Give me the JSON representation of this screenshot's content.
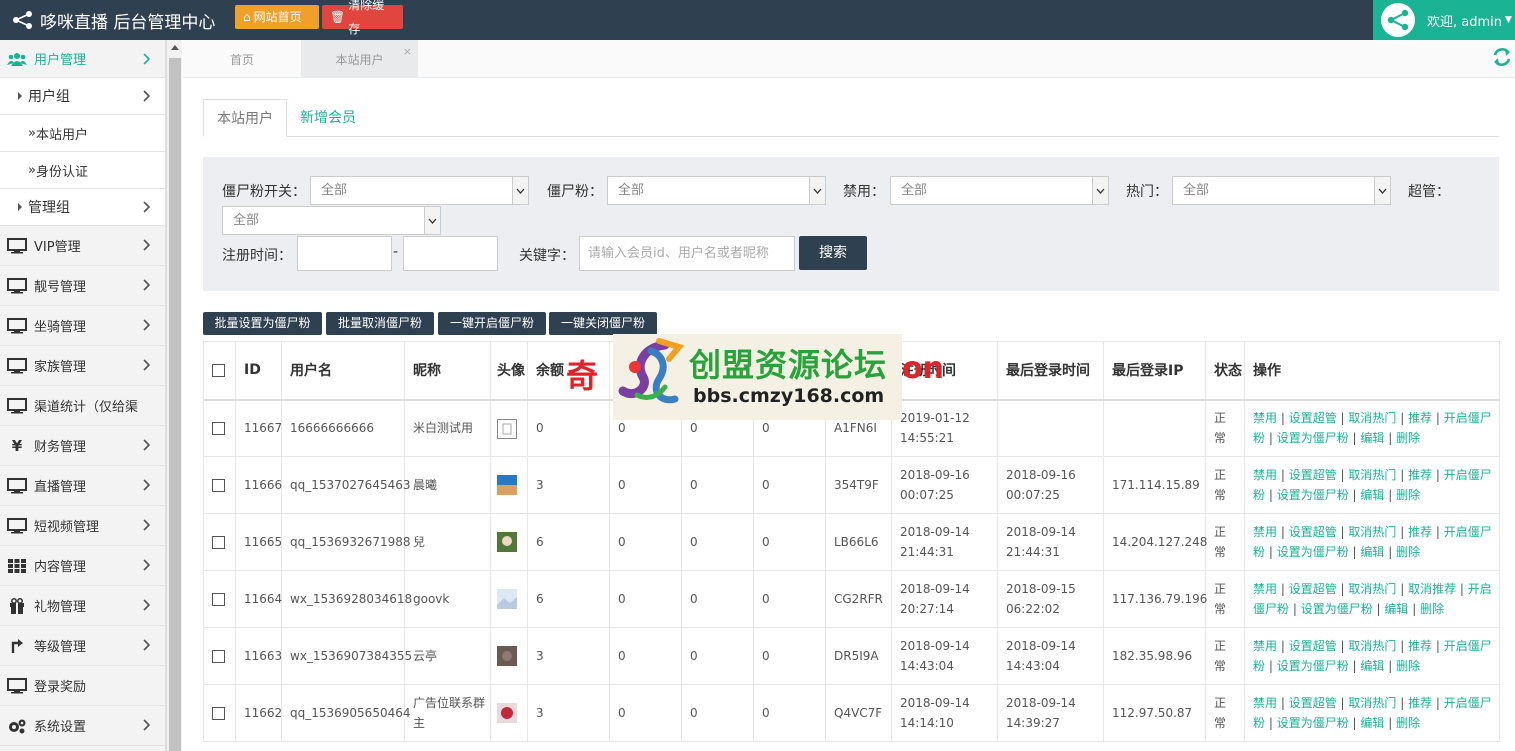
{
  "header": {
    "brand": "哆咪直播 后台管理中心",
    "btn_home": "网站首页",
    "btn_cache": "清除缓存",
    "welcome": "欢迎, admin"
  },
  "sidebar": {
    "user_mgmt": "用户管理",
    "user_group": "用户组",
    "site_users": "本站用户",
    "id_verify": "身份认证",
    "admin_group": "管理组",
    "items": [
      "VIP管理",
      "靓号管理",
      "坐骑管理",
      "家族管理",
      "渠道统计（仅给渠",
      "财务管理",
      "直播管理",
      "短视频管理",
      "内容管理",
      "礼物管理",
      "等级管理",
      "登录奖励",
      "系统设置"
    ]
  },
  "tabs": {
    "home": "首页",
    "current": "本站用户",
    "close": "×"
  },
  "subtabs": {
    "active": "本站用户",
    "other": "新增会员"
  },
  "filters": {
    "zombie_switch_label": "僵尸粉开关：",
    "zombie_label": "僵尸粉：",
    "ban_label": "禁用：",
    "hot_label": "热门：",
    "super_label": "超管：",
    "all": "全部",
    "reg_time_label": "注册时间：",
    "dash": "-",
    "keyword_label": "关键字：",
    "keyword_placeholder": "请输入会员id、用户名或者昵称",
    "search": "搜索"
  },
  "batch": [
    "批量设置为僵尸粉",
    "批量取消僵尸粉",
    "一键开启僵尸粉",
    "一键关闭僵尸粉"
  ],
  "table": {
    "headers": [
      "ID",
      "用户名",
      "昵称",
      "头像",
      "余额",
      "",
      "",
      "",
      "",
      "注册时间",
      "最后登录时间",
      "最后登录IP",
      "状态",
      "操作"
    ],
    "rows": [
      {
        "id": "11667",
        "username": "16666666666",
        "nick": "米白测试用",
        "balance": "0",
        "c1": "0",
        "c2": "0",
        "c3": "0",
        "code": "A1FN6I",
        "reg": "2019-01-12 14:55:21",
        "last": "",
        "ip": "",
        "status": "正常",
        "ops": [
          "禁用",
          "设置超管",
          "取消热门",
          "推荐",
          "开启僵尸粉",
          "设置为僵尸粉",
          "编辑",
          "删除"
        ]
      },
      {
        "id": "11666",
        "username": "qq_1537027645463",
        "nick": "晨曦",
        "balance": "3",
        "c1": "0",
        "c2": "0",
        "c3": "0",
        "code": "354T9F",
        "reg": "2018-09-16 00:07:25",
        "last": "2018-09-16 00:07:25",
        "ip": "171.114.15.89",
        "status": "正常",
        "ops": [
          "禁用",
          "设置超管",
          "取消热门",
          "推荐",
          "开启僵尸粉",
          "设置为僵尸粉",
          "编辑",
          "删除"
        ]
      },
      {
        "id": "11665",
        "username": "qq_1536932671988",
        "nick": "兒",
        "balance": "6",
        "c1": "0",
        "c2": "0",
        "c3": "0",
        "code": "LB66L6",
        "reg": "2018-09-14 21:44:31",
        "last": "2018-09-14 21:44:31",
        "ip": "14.204.127.248",
        "status": "正常",
        "ops": [
          "禁用",
          "设置超管",
          "取消热门",
          "推荐",
          "开启僵尸粉",
          "设置为僵尸粉",
          "编辑",
          "删除"
        ]
      },
      {
        "id": "11664",
        "username": "wx_1536928034618",
        "nick": "goovk",
        "balance": "6",
        "c1": "0",
        "c2": "0",
        "c3": "0",
        "code": "CG2RFR",
        "reg": "2018-09-14 20:27:14",
        "last": "2018-09-15 06:22:02",
        "ip": "117.136.79.196",
        "status": "正常",
        "ops": [
          "禁用",
          "设置超管",
          "取消热门",
          "取消推荐",
          "开启僵尸粉",
          "设置为僵尸粉",
          "编辑",
          "删除"
        ]
      },
      {
        "id": "11663",
        "username": "wx_1536907384355",
        "nick": "云亭",
        "balance": "3",
        "c1": "0",
        "c2": "0",
        "c3": "0",
        "code": "DR5I9A",
        "reg": "2018-09-14 14:43:04",
        "last": "2018-09-14 14:43:04",
        "ip": "182.35.98.96",
        "status": "正常",
        "ops": [
          "禁用",
          "设置超管",
          "取消热门",
          "推荐",
          "开启僵尸粉",
          "设置为僵尸粉",
          "编辑",
          "删除"
        ]
      },
      {
        "id": "11662",
        "username": "qq_1536905650464",
        "nick": "广告位联系群主",
        "balance": "3",
        "c1": "0",
        "c2": "0",
        "c3": "0",
        "code": "Q4VC7F",
        "reg": "2018-09-14 14:14:10",
        "last": "2018-09-14 14:39:27",
        "ip": "112.97.50.87",
        "status": "正常",
        "ops": [
          "禁用",
          "设置超管",
          "取消热门",
          "推荐",
          "开启僵尸粉",
          "设置为僵尸粉",
          "编辑",
          "删除"
        ]
      }
    ]
  },
  "watermark": {
    "title": "创盟资源论坛",
    "url": "bbs.cmzy168.com",
    "red_left": "奇",
    "red_right": "on"
  },
  "colors": {
    "topbar": "#2f4050",
    "accent": "#1ab394",
    "home_btn": "#f0a029",
    "cache_btn": "#e0463e"
  }
}
